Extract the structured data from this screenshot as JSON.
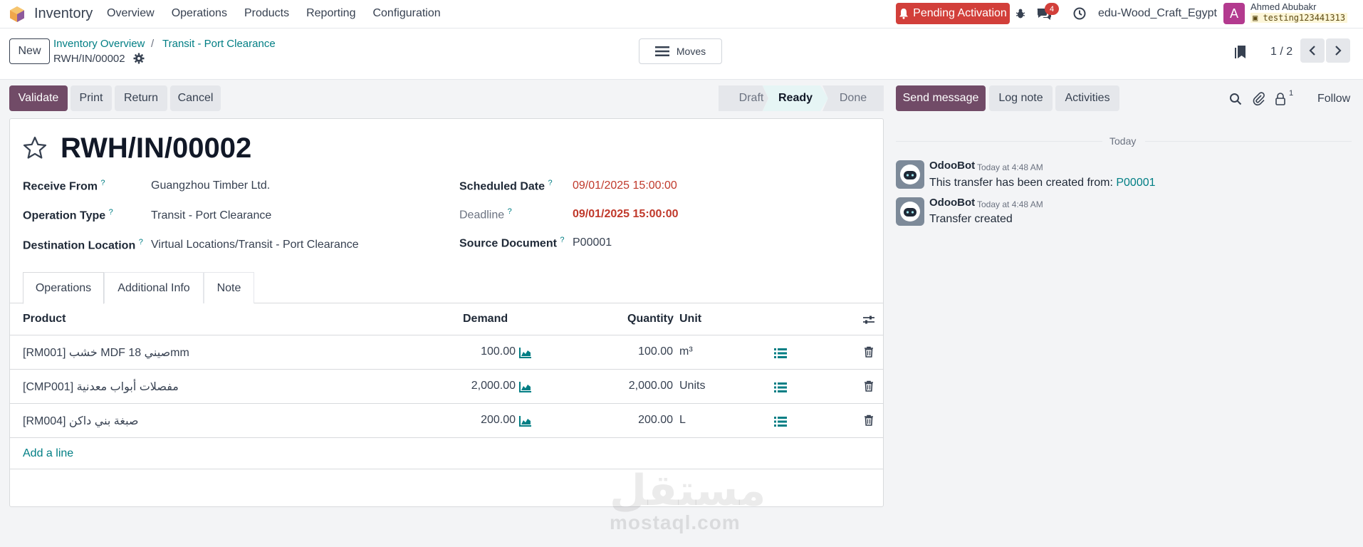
{
  "topnav": {
    "app_name": "Inventory",
    "menu": [
      "Overview",
      "Operations",
      "Products",
      "Reporting",
      "Configuration"
    ],
    "pending_label": "Pending Activation",
    "messages_badge": "4",
    "company": "edu-Wood_Craft_Egypt",
    "avatar_letter": "A",
    "user_name": "Ahmed Abubakr",
    "db_name": "testing123441313",
    "colors": {
      "pending": "#d23f3a",
      "avatar": "#b33a8f"
    }
  },
  "control": {
    "new_label": "New",
    "breadcrumb": [
      "Inventory Overview",
      "Transit - Port Clearance"
    ],
    "breadcrumb_sep": "/",
    "current": "RWH/IN/00002",
    "moves_label": "Moves",
    "pager": "1 / 2"
  },
  "actions": {
    "validate": "Validate",
    "print": "Print",
    "return": "Return",
    "cancel": "Cancel",
    "stages": [
      "Draft",
      "Ready",
      "Done"
    ],
    "active_stage": "Ready"
  },
  "record": {
    "title": "RWH/IN/00002",
    "fields_left": [
      {
        "label": "Receive From",
        "help": "?",
        "value": "Guangzhou Timber Ltd."
      },
      {
        "label": "Operation Type",
        "help": "?",
        "value": "Transit - Port Clearance"
      },
      {
        "label": "Destination Location",
        "help": "?",
        "value": "Virtual Locations/Transit - Port Clearance"
      }
    ],
    "fields_right": [
      {
        "label": "Scheduled Date",
        "help": "?",
        "value": "09/01/2025 15:00:00"
      },
      {
        "label": "Deadline",
        "help": "?",
        "value": "09/01/2025 15:00:00"
      },
      {
        "label": "Source Document",
        "help": "?",
        "value": "P00001"
      }
    ]
  },
  "tabs": [
    "Operations",
    "Additional Info",
    "Note"
  ],
  "table": {
    "headers": {
      "product": "Product",
      "demand": "Demand",
      "quantity": "Quantity",
      "unit": "Unit"
    },
    "rows": [
      {
        "product": "[RM001] خشب MDF 18 صينيmm",
        "demand": "100.00",
        "quantity": "100.00",
        "unit": "m³"
      },
      {
        "product": "[CMP001] مفصلات أبواب معدنية",
        "demand": "2,000.00",
        "quantity": "2,000.00",
        "unit": "Units"
      },
      {
        "product": "[RM004] صبغة بني داكن",
        "demand": "200.00",
        "quantity": "200.00",
        "unit": "L"
      }
    ],
    "add_line": "Add a line"
  },
  "chatter": {
    "send_message": "Send message",
    "log_note": "Log note",
    "activities": "Activities",
    "followers_count": "1",
    "follow": "Follow",
    "today": "Today",
    "messages": [
      {
        "author": "OdooBot",
        "time": "Today at 4:48 AM",
        "body": "This transfer has been created from:",
        "link": "P00001"
      },
      {
        "author": "OdooBot",
        "time": "Today at 4:48 AM",
        "body": "Transfer created"
      }
    ]
  },
  "watermark": {
    "arabic": "مستقل",
    "latin": "mostaql.com"
  }
}
